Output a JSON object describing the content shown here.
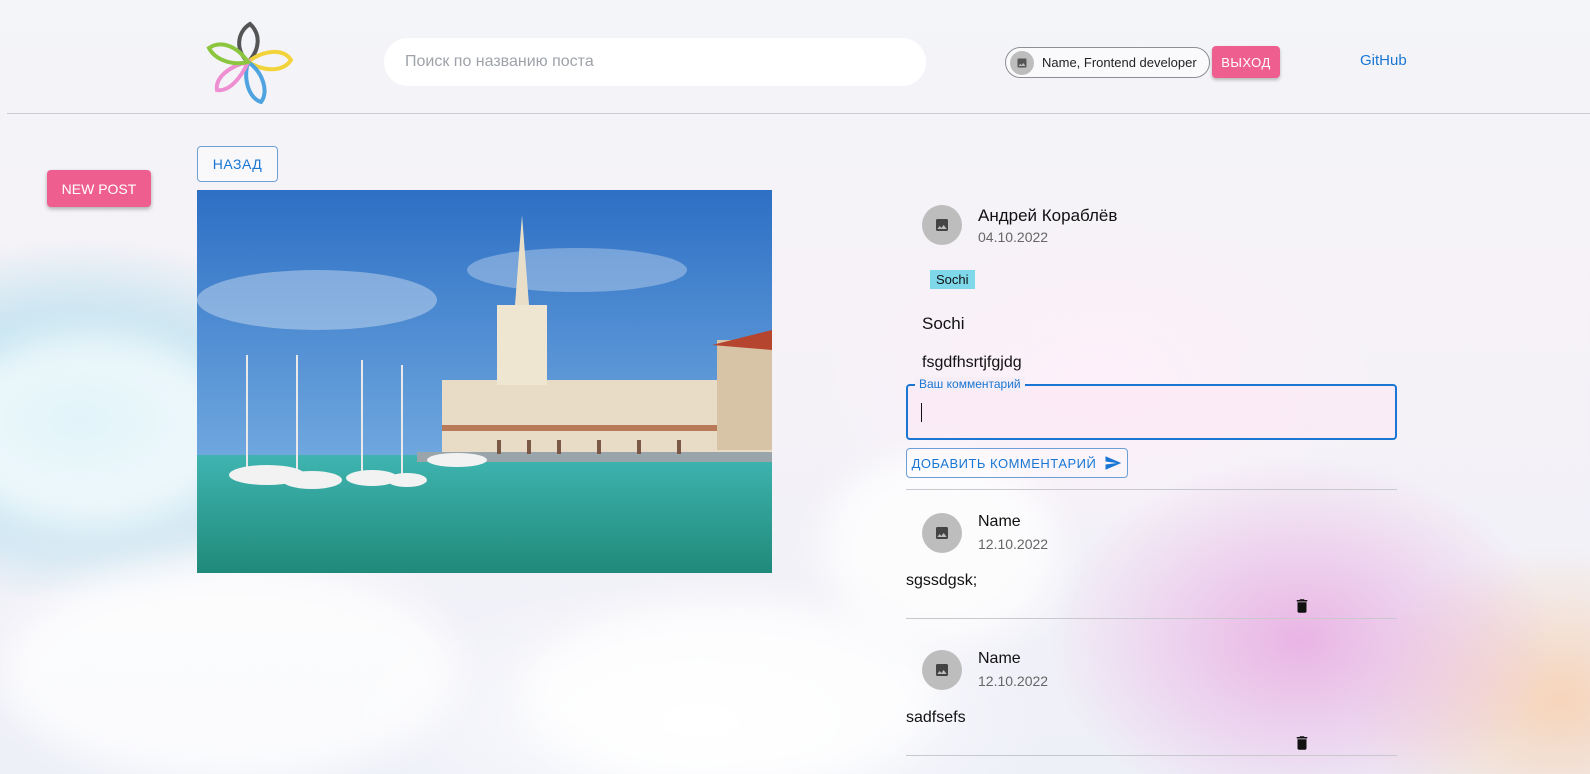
{
  "header": {
    "search_placeholder": "Поиск по названию поста",
    "user_chip": "Name, Frontend developer",
    "logout_label": "ВЫХОД",
    "github_label": "GitHub"
  },
  "sidebar": {
    "new_post_label": "NEW POST"
  },
  "post": {
    "back_label": "НАЗАД",
    "author_name": "Андрей Кораблёв",
    "date": "04.10.2022",
    "tag": "Sochi",
    "title": "Sochi",
    "text": "fsgdfhsrtjfgjdg"
  },
  "comment_form": {
    "label": "Ваш комментарий",
    "value": "",
    "submit_label": "ДОБАВИТЬ КОММЕНТАРИЙ"
  },
  "comments": [
    {
      "author": "Name",
      "date": "12.10.2022",
      "text": "sgssdgsk;"
    },
    {
      "author": "Name",
      "date": "12.10.2022",
      "text": "sadfsefs"
    }
  ],
  "colors": {
    "accent_pink": "#ee5f8f",
    "link_blue": "#1976d2",
    "tag_bg": "#7fd7ea"
  }
}
